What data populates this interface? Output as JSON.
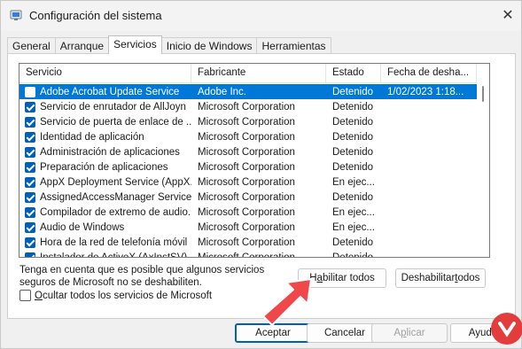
{
  "window": {
    "title": "Configuración del sistema",
    "close_glyph": "✕"
  },
  "tabs": [
    {
      "label": "General",
      "active": false
    },
    {
      "label": "Arranque",
      "active": false
    },
    {
      "label": "Servicios",
      "active": true
    },
    {
      "label": "Inicio de Windows",
      "active": false
    },
    {
      "label": "Herramientas",
      "active": false
    }
  ],
  "services": {
    "headers": {
      "service": "Servicio",
      "maker": "Fabricante",
      "state": "Estado",
      "date": "Fecha de desha..."
    },
    "rows": [
      {
        "name": "Adobe Acrobat Update Service",
        "maker": "Adobe Inc.",
        "state": "Detenido",
        "date": "1/02/2023 1:18...",
        "checked": false,
        "selected": true
      },
      {
        "name": "Servicio de enrutador de AllJoyn",
        "maker": "Microsoft Corporation",
        "state": "Detenido",
        "date": "",
        "checked": true,
        "selected": false
      },
      {
        "name": "Servicio de puerta de enlace de ...",
        "maker": "Microsoft Corporation",
        "state": "Detenido",
        "date": "",
        "checked": true,
        "selected": false
      },
      {
        "name": "Identidad de aplicación",
        "maker": "Microsoft Corporation",
        "state": "Detenido",
        "date": "",
        "checked": true,
        "selected": false
      },
      {
        "name": "Administración de aplicaciones",
        "maker": "Microsoft Corporation",
        "state": "Detenido",
        "date": "",
        "checked": true,
        "selected": false
      },
      {
        "name": "Preparación de aplicaciones",
        "maker": "Microsoft Corporation",
        "state": "Detenido",
        "date": "",
        "checked": true,
        "selected": false
      },
      {
        "name": "AppX Deployment Service (AppX...",
        "maker": "Microsoft Corporation",
        "state": "En ejec...",
        "date": "",
        "checked": true,
        "selected": false
      },
      {
        "name": "AssignedAccessManager Service",
        "maker": "Microsoft Corporation",
        "state": "Detenido",
        "date": "",
        "checked": true,
        "selected": false
      },
      {
        "name": "Compilador de extremo de audio...",
        "maker": "Microsoft Corporation",
        "state": "En ejec...",
        "date": "",
        "checked": true,
        "selected": false
      },
      {
        "name": "Audio de Windows",
        "maker": "Microsoft Corporation",
        "state": "En ejec...",
        "date": "",
        "checked": true,
        "selected": false
      },
      {
        "name": "Hora de la red de telefonía móvil",
        "maker": "Microsoft Corporation",
        "state": "Detenido",
        "date": "",
        "checked": true,
        "selected": false
      },
      {
        "name": "Instalador de ActiveX (AxInstSV)",
        "maker": "Microsoft Corporation",
        "state": "Detenido",
        "date": "",
        "checked": true,
        "selected": false
      }
    ]
  },
  "note": "Tenga en cuenta que es posible que algunos servicios seguros de Microsoft no se deshabiliten.",
  "buttons": {
    "enable_all_pre": "H",
    "enable_all_u": "a",
    "enable_all_post": "bilitar todos",
    "disable_all_pre": "Deshabilitar ",
    "disable_all_u": "t",
    "disable_all_post": "odos",
    "ok": "Aceptar",
    "cancel": "Cancelar",
    "apply_pre": "A",
    "apply_u": "p",
    "apply_post": "licar",
    "help": "Ayuda"
  },
  "hide_ms": {
    "u": "O",
    "rest": "cultar todos los servicios de Microsoft",
    "checked": false
  },
  "colors": {
    "accent": "#0078d7",
    "arrow": "#f0474b",
    "watermark": "#e23c3c"
  }
}
